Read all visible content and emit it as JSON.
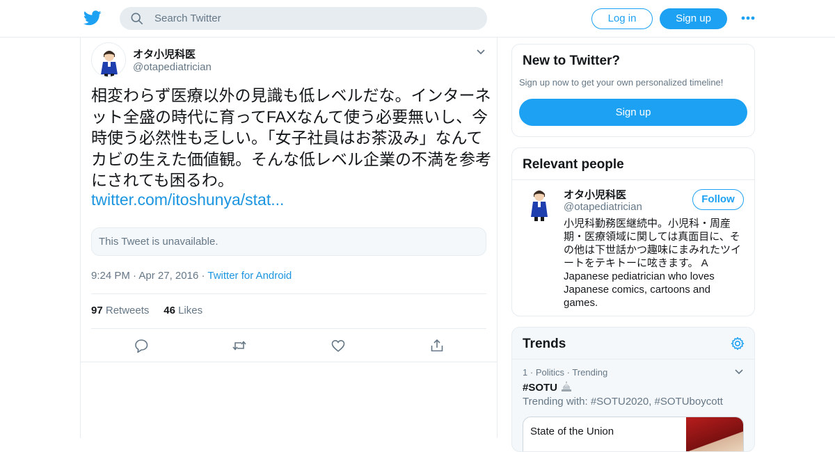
{
  "header": {
    "logo": "twitter-bird-icon",
    "search_placeholder": "Search Twitter",
    "login_label": "Log in",
    "signup_label": "Sign up",
    "more_icon": "more-dots-icon"
  },
  "tweet": {
    "author_name": "オタ小児科医",
    "author_handle": "@otapediatrician",
    "text": "相変わらず医療以外の見識も低レベルだな。インターネット全盛の時代に育ってFAXなんて使う必要無いし、今時使う必然性も乏しい。「女子社員はお茶汲み」なんてカビの生えた価値観。そんな低レベル企業の不満を参考にされても困るわ。",
    "link_text": "twitter.com/itoshunya/stat...",
    "quoted_unavailable": "This Tweet is unavailable.",
    "time": "9:24 PM",
    "date": "Apr 27, 2016",
    "source": "Twitter for Android",
    "retweets_count": "97",
    "retweets_label": "Retweets",
    "likes_count": "46",
    "likes_label": "Likes"
  },
  "sidebar": {
    "new_to_twitter": {
      "title": "New to Twitter?",
      "subtitle": "Sign up now to get your own personalized timeline!",
      "signup_label": "Sign up"
    },
    "relevant_people": {
      "title": "Relevant people",
      "name": "オタ小児科医",
      "handle": "@otapediatrician",
      "follow_label": "Follow",
      "bio": "小児科勤務医継続中。小児科・周産期・医療領域に関しては真面目に、その他は下世話かつ趣味にまみれたツイートをテキトーに呟きます。 A Japanese pediatrician who loves Japanese comics, cartoons and games."
    },
    "trends": {
      "title": "Trends",
      "item": {
        "rank": "1",
        "category": "Politics",
        "status": "Trending",
        "hashtag": "#SOTU",
        "trending_with": "Trending with: #SOTU2020, #SOTUboycott",
        "card_title": "State of the Union"
      }
    }
  },
  "colors": {
    "brand": "#1da1f2",
    "link": "#1b95e0",
    "secondary_text": "#657786",
    "border": "#e6ecf0"
  }
}
